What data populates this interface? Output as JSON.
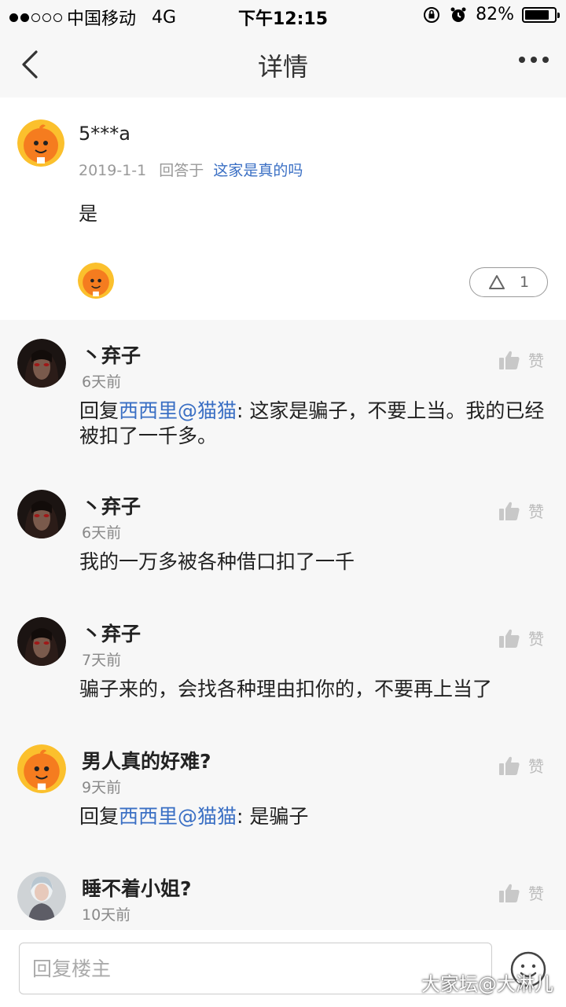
{
  "status_bar": {
    "carrier": "中国移动",
    "network": "4G",
    "time": "下午12:15",
    "battery": "82%",
    "battery_level": 0.82
  },
  "nav": {
    "title": "详情"
  },
  "main_post": {
    "username": "5***a",
    "date": "2019-1-1",
    "answer_prefix": "回答于",
    "question_link": "这家是真的吗",
    "content": "是",
    "like_count": "1"
  },
  "comments": [
    {
      "name": "丶弃子",
      "time": "6天前",
      "reply_prefix": "回复",
      "mention": "西西里@猫猫",
      "text": ": 这家是骗子，不要上当。我的已经被扣了一千多。",
      "like_label": "赞",
      "avatar": "dark-portrait"
    },
    {
      "name": "丶弃子",
      "time": "6天前",
      "reply_prefix": "",
      "mention": "",
      "text": "我的一万多被各种借口扣了一千",
      "like_label": "赞",
      "avatar": "dark-portrait"
    },
    {
      "name": "丶弃子",
      "time": "7天前",
      "reply_prefix": "",
      "mention": "",
      "text": "骗子来的，会找各种理由扣你的，不要再上当了",
      "like_label": "赞",
      "avatar": "dark-portrait"
    },
    {
      "name": "男人真的好难?",
      "time": "9天前",
      "reply_prefix": "回复",
      "mention": "西西里@猫猫",
      "text": ": 是骗子",
      "like_label": "赞",
      "avatar": "orange-mascot"
    },
    {
      "name": "睡不着小姐?",
      "time": "10天前",
      "reply_prefix": "",
      "mention": "",
      "text": "",
      "like_label": "赞",
      "avatar": "photo-girl"
    }
  ],
  "bottom": {
    "reply_placeholder": "回复楼主"
  },
  "watermark": "大家坛@大淋儿",
  "colors": {
    "link": "#3a6fc4",
    "mascot_orange": "#f57c1f",
    "mascot_ring": "#fbc02d"
  }
}
